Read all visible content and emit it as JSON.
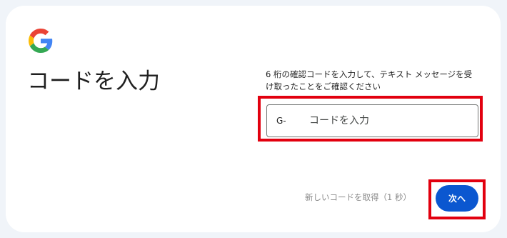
{
  "header": {
    "logo_icon": "google-g-icon",
    "title": "コードを入力"
  },
  "main": {
    "description": "6 桁の確認コードを入力して、テキスト メッセージを受け取ったことをご確認ください",
    "code_prefix": "G-",
    "code_placeholder": "コードを入力",
    "code_value": ""
  },
  "footer": {
    "resend_label": "新しいコードを取得（1 秒）",
    "next_label": "次へ"
  },
  "colors": {
    "page_background": "#f0f4f9",
    "card_background": "#ffffff",
    "primary_button": "#0b57d0",
    "highlight_box": "#e2000f",
    "disabled_text": "#8a8a8a"
  }
}
